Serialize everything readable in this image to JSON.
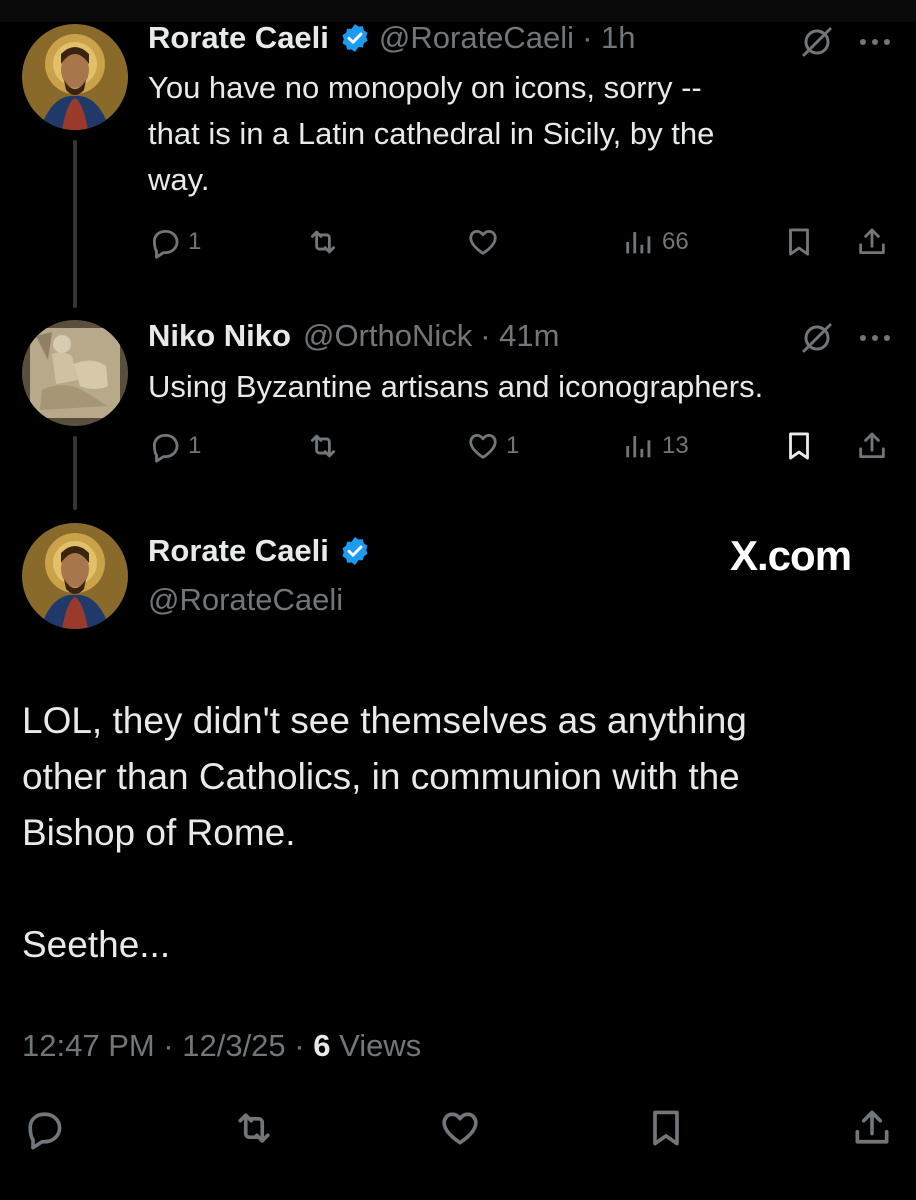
{
  "colors": {
    "background": "#000000",
    "text": "#e7e9ea",
    "muted": "#71767b",
    "verified": "#1d9bf0",
    "divider": "#333639"
  },
  "tweets": [
    {
      "name": "Rorate Caeli",
      "verified": true,
      "handle": "@RorateCaeli",
      "time": "· 1h",
      "text_lines": [
        "You have no monopoly on icons, sorry --",
        "that is in a Latin cathedral in Sicily, by the",
        "way."
      ],
      "avatar_icon": "icon-avatar",
      "replies": "1",
      "reposts": "",
      "likes": "",
      "views": "66"
    },
    {
      "name": "Niko Niko",
      "verified": false,
      "handle": "@OrthoNick",
      "time": "· 41m",
      "text_lines": [
        "Using Byzantine artisans and iconographers."
      ],
      "avatar_icon": "ivory-relief-avatar",
      "replies": "1",
      "reposts": "",
      "likes": "1",
      "views": "13"
    }
  ],
  "main_tweet": {
    "name": "Rorate Caeli",
    "handle": "@RorateCaeli",
    "verified": true,
    "watermark": "X.com",
    "paragraph1": [
      "LOL, they didn't see themselves as anything",
      "other than Catholics, in communion with the",
      "Bishop of Rome."
    ],
    "paragraph2": "Seethe...",
    "meta_prefix": "12:47 PM · 12/3/25 · ",
    "meta_views_count": "6",
    "meta_views_label": " Views"
  },
  "icons": [
    "verified-badge-icon",
    "grok-icon",
    "more-icon",
    "reply-icon",
    "repost-icon",
    "like-icon",
    "views-icon",
    "bookmark-icon",
    "share-icon"
  ]
}
